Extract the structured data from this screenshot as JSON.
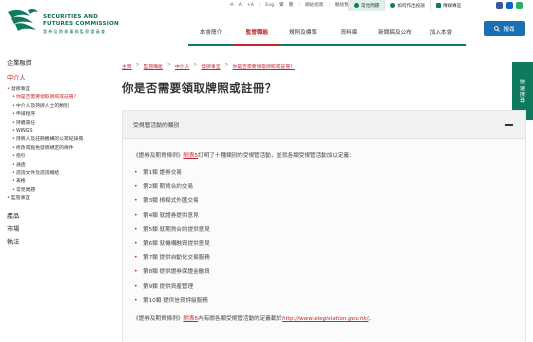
{
  "topbar": {
    "font_sizes": [
      "-A",
      "A",
      "+A"
    ],
    "languages": [
      "Eng",
      "繁",
      "簡"
    ],
    "site_map": "網站指南",
    "contact": "聯絡我們",
    "faq": "常見問題",
    "complaint": "如何作出投訴",
    "media": "傳媒專區"
  },
  "header": {
    "logo_line1": "SECURITIES AND",
    "logo_line2": "FUTURES COMMISSION",
    "logo_sub": "證 券 及 期 貨 事 務 監 察 委 員 會",
    "search_label": "搜尋"
  },
  "nav": {
    "items": [
      "本會簡介",
      "監管職能",
      "規則及標準",
      "資料庫",
      "新聞稿及公布",
      "加入本會"
    ],
    "active_index": 1
  },
  "sidetab": {
    "label": "快速搜尋"
  },
  "sidebar": {
    "section": "企業融資",
    "sub_active": "中介人",
    "items": [
      {
        "level": 1,
        "text": "發牌事宜"
      },
      {
        "level": 2,
        "text": "你是否需要領取牌照或註冊？",
        "current": true
      },
      {
        "level": 2,
        "text": "中介人及持牌人士的類別"
      },
      {
        "level": 2,
        "text": "申請程序"
      },
      {
        "level": 2,
        "text": "持續責任"
      },
      {
        "level": 2,
        "text": "WINGS"
      },
      {
        "level": 2,
        "text": "持牌人及註冊機構的公眾紀錄冊"
      },
      {
        "level": 2,
        "text": "修改或豁免發牌規定的條件"
      },
      {
        "level": 2,
        "text": "指引"
      },
      {
        "level": 2,
        "text": "通函"
      },
      {
        "level": 2,
        "text": "諮詢文件及諮詢總結"
      },
      {
        "level": 2,
        "text": "表格"
      },
      {
        "level": 2,
        "text": "常見問題"
      },
      {
        "level": 1,
        "text": "監管事宜"
      }
    ],
    "bottom": [
      "產品",
      "市場",
      "執法"
    ]
  },
  "breadcrumb": [
    "主頁",
    "監管職能",
    "中介人",
    "發牌事宜",
    "你是否需要領取牌照或註冊？"
  ],
  "page_title": "你是否需要領取牌照或註冊？",
  "panel": {
    "heading": "受規管活動的類別",
    "intro_pre": "《證券及期貨條例》",
    "intro_link": "附表5",
    "intro_post": "訂明了十種類別的受規管活動，並就各類受規管活動加以定義：",
    "types": [
      "第1類 證券交易",
      "第2類 期貨合約交易",
      "第3類 槓桿式外匯交易",
      "第4類 就證券提供意見",
      "第5類 就期貨合約提供意見",
      "第6類 就機構融資提供意見",
      "第7類 提供自動化交易服務",
      "第8類 提供證券保證金融資",
      "第9類 提供資產管理",
      "第10類 提供信貸評級服務"
    ],
    "outro_pre": "《證券及期貨條例》",
    "outro_link": "附表5",
    "outro_mid": "內有關各類受規管活動的定義載於",
    "outro_url": "http://www.elegislation.gov.hk/",
    "outro_end": "。"
  },
  "colors": {
    "brand_green": "#0e7a5f",
    "accent_red": "#c0272d",
    "search_blue": "#1a6fb5"
  }
}
